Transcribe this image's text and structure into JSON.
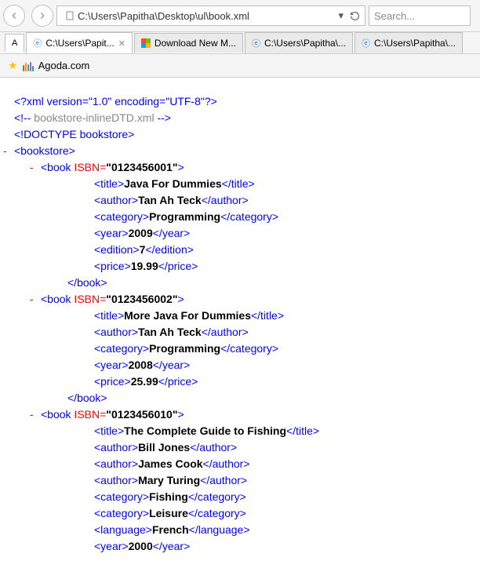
{
  "navbar": {
    "address": "C:\\Users\\Papitha\\Desktop\\ul\\book.xml",
    "search_placeholder": "Search..."
  },
  "tabs": [
    {
      "label": "C:\\Users\\Papit...",
      "icon": "ie",
      "active": true,
      "closable": true
    },
    {
      "label": "Download New M...",
      "icon": "ms",
      "active": false,
      "closable": false
    },
    {
      "label": "C:\\Users\\Papitha\\...",
      "icon": "ie",
      "active": false,
      "closable": false
    },
    {
      "label": "C:\\Users\\Papitha\\...",
      "icon": "ie",
      "active": false,
      "closable": false
    }
  ],
  "favbar": {
    "label": "Agoda.com"
  },
  "chart_data": {
    "type": "table",
    "title": "bookstore XML",
    "declaration": {
      "version": "1.0",
      "encoding": "UTF-8"
    },
    "comment": "bookstore-inlineDTD.xml",
    "doctype": "bookstore",
    "root": "bookstore",
    "books": [
      {
        "ISBN": "0123456001",
        "title": "Java For Dummies",
        "authors": [
          "Tan Ah Teck"
        ],
        "categories": [
          "Programming"
        ],
        "year": "2009",
        "edition": "7",
        "price": "19.99"
      },
      {
        "ISBN": "0123456002",
        "title": "More Java For Dummies",
        "authors": [
          "Tan Ah Teck"
        ],
        "categories": [
          "Programming"
        ],
        "year": "2008",
        "price": "25.99"
      },
      {
        "ISBN": "0123456010",
        "title": "The Complete Guide to Fishing",
        "authors": [
          "Bill Jones",
          "James Cook",
          "Mary Turing"
        ],
        "categories": [
          "Fishing",
          "Leisure"
        ],
        "language": "French",
        "year": "2000"
      }
    ]
  },
  "xml": {
    "decl": "<?xml version=\"1.0\" encoding=\"UTF-8\"?>",
    "comment_open": "<!-- ",
    "comment_text": "bookstore-inlineDTD.xml",
    "comment_close": " -->",
    "doctype": "<!DOCTYPE bookstore>",
    "bookstore_open": "<bookstore>",
    "book_open": "<book",
    "book_close": "</book>",
    "isbn_attr": " ISBN=",
    "q": "\"",
    "gt": ">",
    "title_o": "<title>",
    "title_c": "</title>",
    "author_o": "<author>",
    "author_c": "</author>",
    "category_o": "<category>",
    "category_c": "</category>",
    "year_o": "<year>",
    "year_c": "</year>",
    "edition_o": "<edition>",
    "edition_c": "</edition>",
    "price_o": "<price>",
    "price_c": "</price>",
    "language_o": "<language>",
    "language_c": "</language>",
    "dash": "- ",
    "b0_isbn": "0123456001",
    "b0_title": "Java For Dummies",
    "b0_a0": "Tan Ah Teck",
    "b0_c0": "Programming",
    "b0_year": "2009",
    "b0_edition": "7",
    "b0_price": "19.99",
    "b1_isbn": "0123456002",
    "b1_title": "More Java For Dummies",
    "b1_a0": "Tan Ah Teck",
    "b1_c0": "Programming",
    "b1_year": "2008",
    "b1_price": "25.99",
    "b2_isbn": "0123456010",
    "b2_title": "The Complete Guide to Fishing",
    "b2_a0": "Bill Jones",
    "b2_a1": "James Cook",
    "b2_a2": "Mary Turing",
    "b2_c0": "Fishing",
    "b2_c1": "Leisure",
    "b2_lang": "French",
    "b2_year": "2000"
  }
}
